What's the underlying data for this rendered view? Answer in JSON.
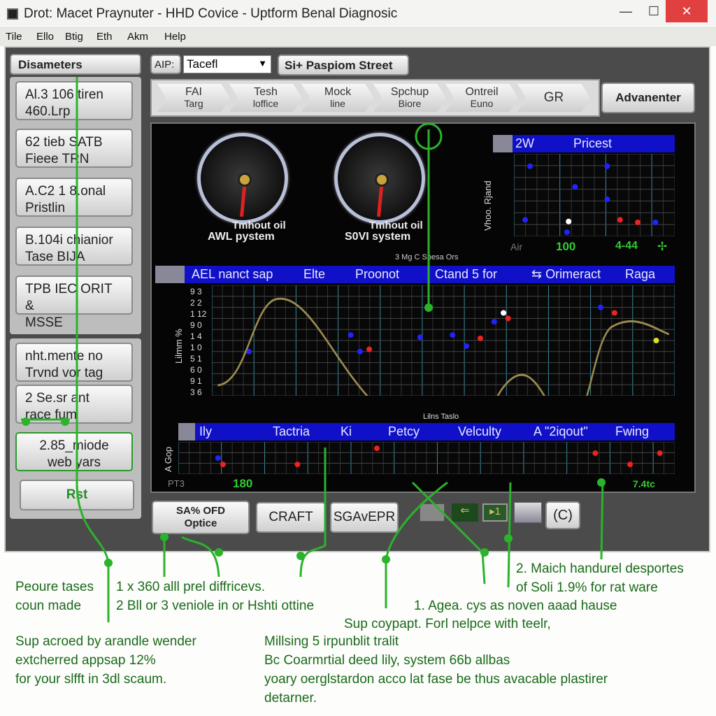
{
  "window": {
    "title": "Drot: Macet Praynuter - HHD Covice - Uptform Benal Diagnosic",
    "minimize": "—",
    "maximize": "☐",
    "close": "✕"
  },
  "menu": [
    "Tile",
    "Ello",
    "Btig",
    "Eth",
    "Akm",
    "Help"
  ],
  "sidebar": {
    "header": "Disameters",
    "items": [
      {
        "line1": "Al.3 106  tiren",
        "line2": "460.Lrp"
      },
      {
        "line1": "62 tieb  SATB",
        "line2": "Fieee   TRN"
      },
      {
        "line1": "A.C2 1 8.onal",
        "line2": "Pristlin"
      },
      {
        "line1": "B.104i chianior",
        "line2": "Tase       BIJA"
      },
      {
        "line1": "TPB IEC ORIT &",
        "line2": "MSSE"
      },
      {
        "line1": "nht.mente no",
        "line2": "Trvnd vor tag"
      },
      {
        "line1": "2 Se.sr ant",
        "line2": "race fum"
      },
      {
        "line1": "2.85_miode",
        "line2": "web yars"
      }
    ],
    "action": "Rst"
  },
  "toolbar": {
    "aip_label": "AIP:",
    "aip_value": "Tacefl",
    "street_button": "Si+ Paspiom Street"
  },
  "steps": [
    {
      "l1": "FAI",
      "l2": "Targ"
    },
    {
      "l1": "Tesh",
      "l2": "loffice"
    },
    {
      "l1": "Mock",
      "l2": "line"
    },
    {
      "l1": "Spchup",
      "l2": "Biore"
    },
    {
      "l1": "Ontreil",
      "l2": "Euno"
    },
    {
      "l1": "GR",
      "l2": ""
    }
  ],
  "advance_button": "Advanenter",
  "gauges": [
    {
      "top": "Tmhout oil",
      "label": "AWL pystem",
      "level": 0.52
    },
    {
      "top": "Tmhout oil",
      "label": "S0VI system",
      "level": 0.52
    }
  ],
  "small_grid": {
    "headers": [
      "2W",
      "Pricest"
    ],
    "ylabel": "Vhoo. Rjand",
    "footer": [
      "Air",
      "100",
      "4-44",
      "✢"
    ]
  },
  "main_grid": {
    "caption": "3 Mg C Sbesa Ors",
    "headers": [
      "AEL nanct sap",
      "Elte",
      "Proonot",
      "Ctand 5 for",
      "⇆ Orimeract",
      "Raga"
    ],
    "ylabel": "Lilmm %",
    "yticks": [
      "9 3",
      "2 2",
      "1 12",
      "9 0",
      "1 4",
      "1 0",
      "5 1",
      "6 0",
      "9 1",
      "3 6"
    ],
    "footer_caption": "Lilns Taslo"
  },
  "bottom_grid": {
    "headers": [
      "Ily",
      "Tactria",
      "Ki",
      "Petcy",
      "Velculty",
      "A \"2iqout\"",
      "Fwing"
    ],
    "ylabel": "A Gop",
    "footer": [
      "PT3",
      "180",
      "7.4tc"
    ]
  },
  "buttons": {
    "options": "SA% OFD\nOptice",
    "craft": "CRAFT",
    "save": "SGAvEPR",
    "c": "(C)"
  },
  "annotations": [
    {
      "l": "Peoure tases\ncoun made"
    },
    {
      "l": "1 x 360 alll prel diffricevs.\n2 Bll or 3 veniole in or Hshti ottine"
    },
    {
      "l": "2. Maich handurel desportes\nof Soli 1.9% for rat ware"
    },
    {
      "l": "1. Agea. cys as noven aaad hause"
    },
    {
      "l": "Sup coypapt. Forl nelpce with teelr,"
    },
    {
      "l": "Sup acroed by arandle wender\nextcherred appsap 12%\nfor your slfft in 3dl scaum."
    },
    {
      "l": "Millsing 5 irpunblit tralit\nBc Coarmrtial deed lily, system 66b allbas\nyoary oerglstardon acco lat fase be thus avacable plastirer\ndetarner."
    }
  ],
  "colors": {
    "header_blue": "#1010c8",
    "callout_green": "#2bb32b",
    "background": "#4b4b4b"
  }
}
